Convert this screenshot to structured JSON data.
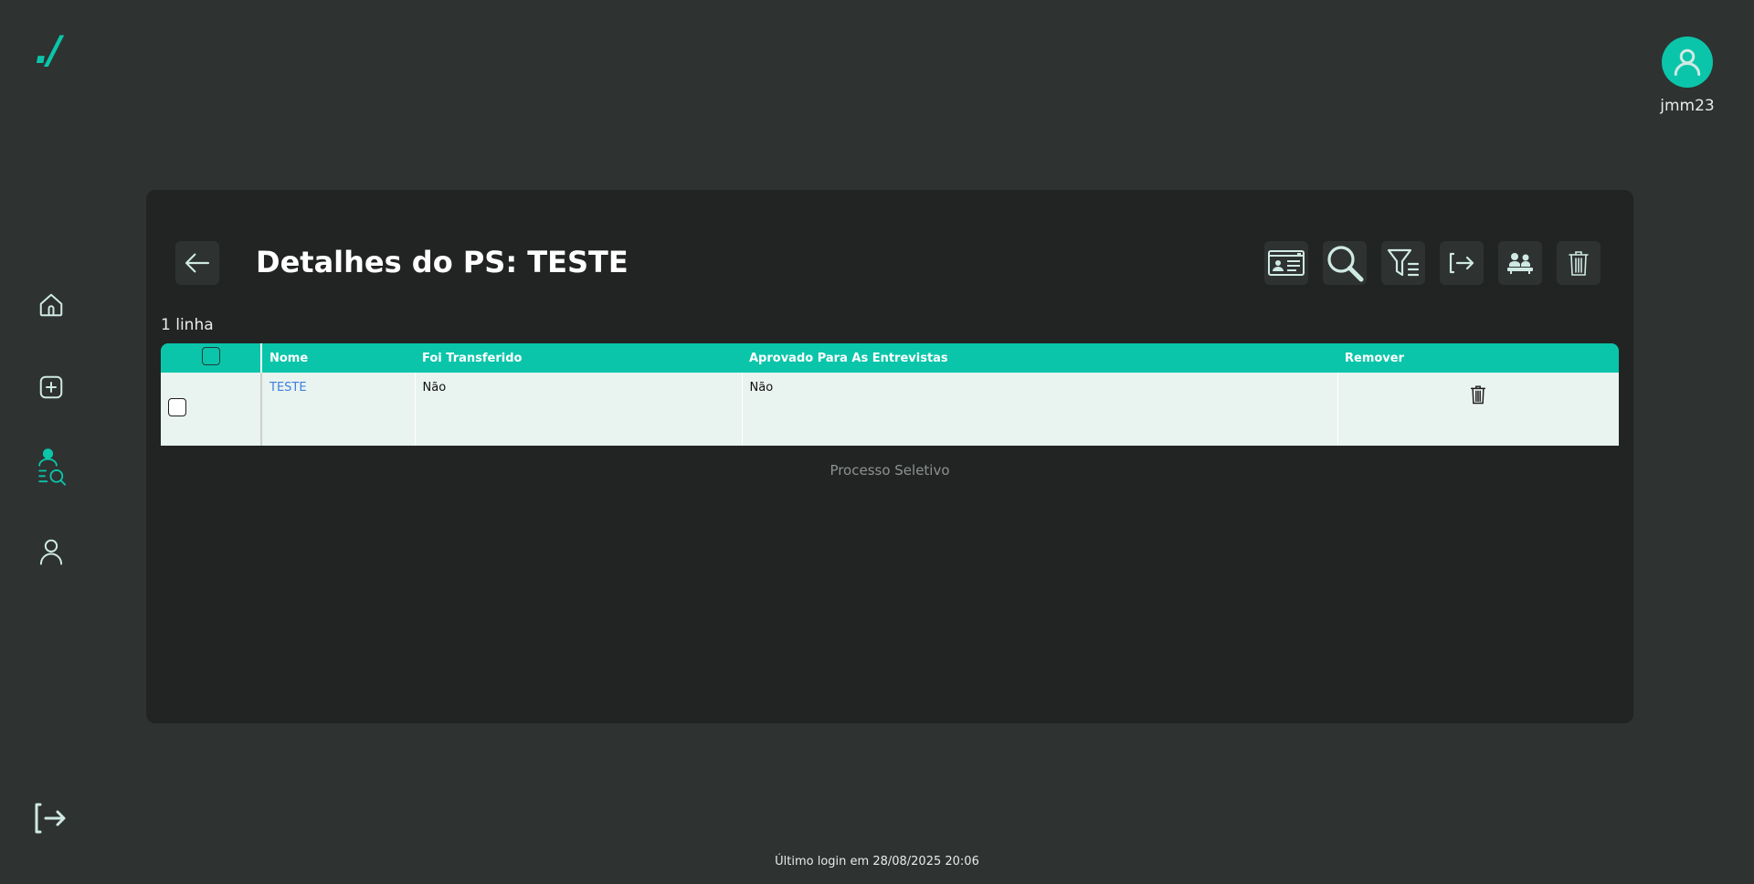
{
  "brand": {
    "logo_text": "./",
    "accent": "#0bc5aa"
  },
  "user": {
    "name": "jmm23",
    "icon": "user-avatar-icon"
  },
  "sidebar": {
    "items": [
      {
        "name": "home",
        "icon": "home-icon"
      },
      {
        "name": "add",
        "icon": "plus-square-icon"
      },
      {
        "name": "search-person",
        "icon": "person-search-icon",
        "active": true
      },
      {
        "name": "profile",
        "icon": "user-icon"
      }
    ],
    "logout_icon": "logout-icon"
  },
  "panel": {
    "title": "Detalhes do PS: TESTE",
    "back_icon": "arrow-left-icon",
    "toolbar": [
      {
        "name": "id-card",
        "icon": "id-card-icon"
      },
      {
        "name": "search",
        "icon": "search-icon"
      },
      {
        "name": "filter",
        "icon": "filter-list-icon"
      },
      {
        "name": "transfer",
        "icon": "transfer-icon"
      },
      {
        "name": "interviews",
        "icon": "people-table-icon"
      },
      {
        "name": "delete",
        "icon": "trash-icon"
      }
    ],
    "row_count": "1 linha",
    "table": {
      "columns": [
        "Nome",
        "Foi Transferido",
        "Aprovado Para As Entrevistas",
        "Remover"
      ],
      "rows": [
        {
          "nome": "TESTE",
          "foi_transferido": "Não",
          "aprovado": "Não"
        }
      ]
    },
    "caption": "Processo Seletivo"
  },
  "footer": {
    "last_login": "Último login em 28/08/2025 20:06"
  }
}
